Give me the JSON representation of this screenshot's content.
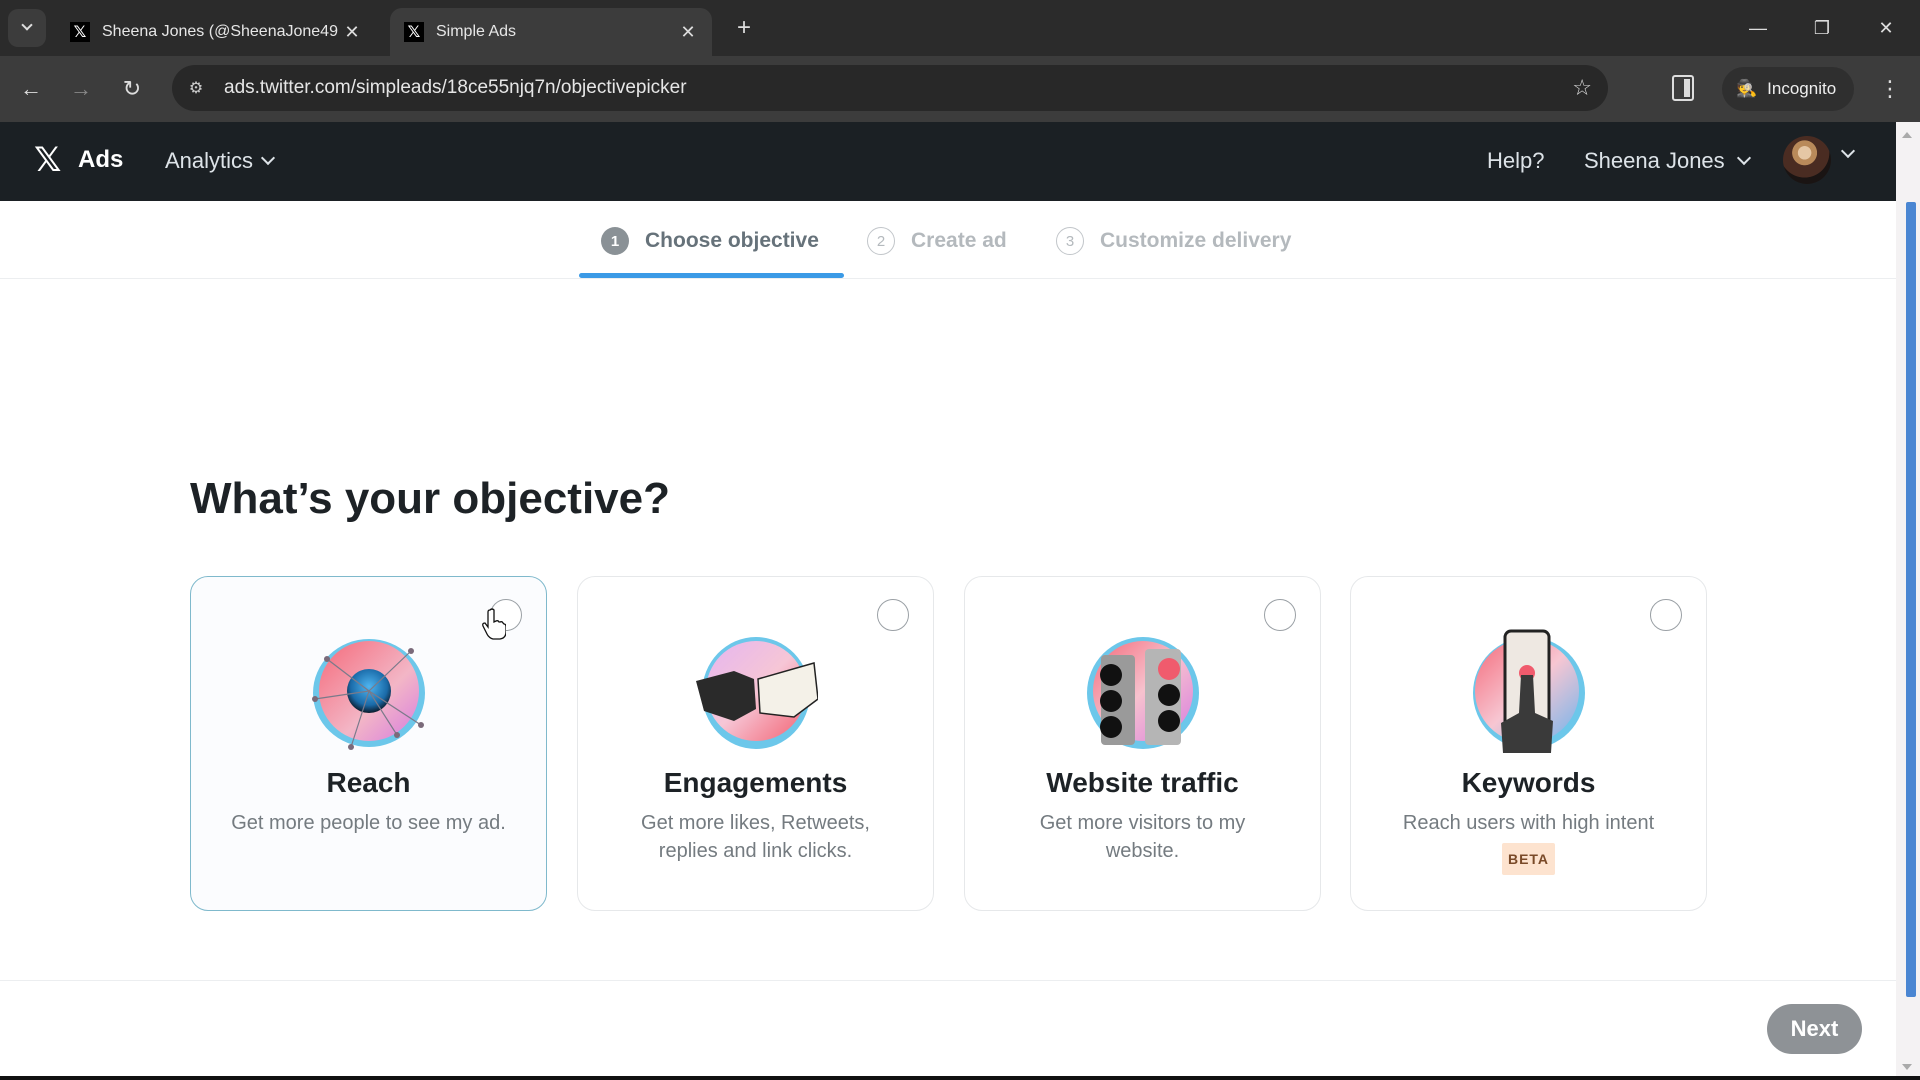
{
  "browser": {
    "tabs": [
      {
        "title": "Sheena Jones (@SheenaJone49",
        "favicon": "x-logo-icon",
        "active": false
      },
      {
        "title": "Simple Ads",
        "favicon": "x-logo-icon",
        "active": true
      }
    ],
    "new_tab_label": "+",
    "url": "ads.twitter.com/simpleads/18ce55njq7n/objectivepicker",
    "incognito_label": "Incognito"
  },
  "header": {
    "logo_glyph": "𝕏",
    "product": "Ads",
    "analytics_label": "Analytics",
    "help_label": "Help?",
    "user_name": "Sheena Jones"
  },
  "stepper": {
    "steps": [
      {
        "number": "1",
        "label": "Choose objective",
        "state": "active"
      },
      {
        "number": "2",
        "label": "Create ad",
        "state": "pending"
      },
      {
        "number": "3",
        "label": "Customize delivery",
        "state": "pending"
      }
    ]
  },
  "main": {
    "title": "What’s your objective?",
    "objectives": [
      {
        "name": "Reach",
        "description": "Get more people to see my ad.",
        "icon": "reach-illustration-icon",
        "hovered": true,
        "selected": false
      },
      {
        "name": "Engagements",
        "description": "Get more likes, Retweets, replies and link clicks.",
        "icon": "fist-bump-illustration-icon",
        "selected": false
      },
      {
        "name": "Website traffic",
        "description": "Get more visitors to my website.",
        "icon": "traffic-light-illustration-icon",
        "selected": false
      },
      {
        "name": "Keywords",
        "description": "Reach users with high intent",
        "badge": "BETA",
        "icon": "phone-tap-illustration-icon",
        "selected": false
      }
    ]
  },
  "footer": {
    "next_label": "Next",
    "next_enabled": false
  },
  "colors": {
    "accent": "#3b9ae6",
    "header_bg": "#1b2024",
    "beta_bg": "#fde3cf",
    "next_disabled": "#8e9296"
  }
}
